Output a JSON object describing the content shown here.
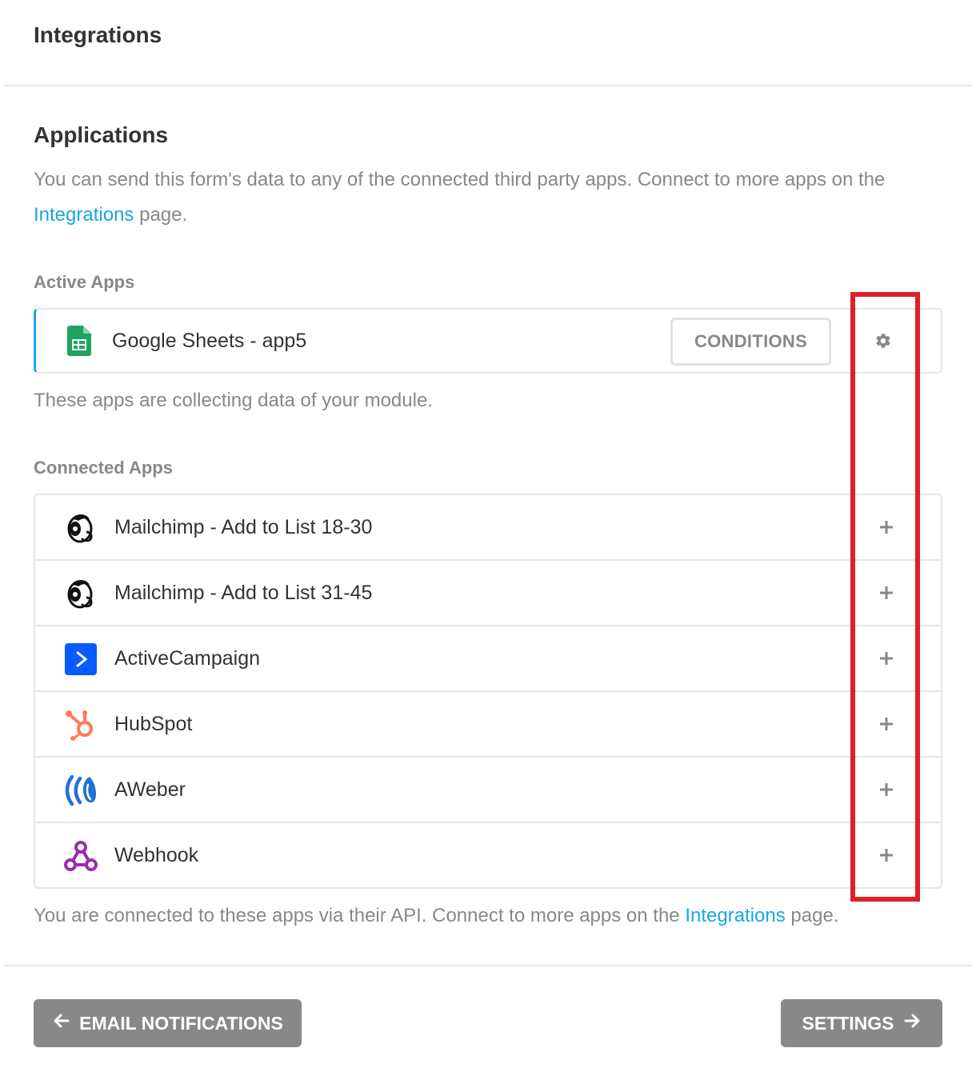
{
  "header": {
    "title": "Integrations"
  },
  "applications": {
    "title": "Applications",
    "description_prefix": "You can send this form's data to any of the connected third party apps. Connect to more apps on the",
    "integrations_link": "Integrations",
    "description_suffix": "page."
  },
  "active_apps": {
    "label": "Active Apps",
    "items": [
      {
        "name": "Google Sheets - app5",
        "icon": "google-sheets-icon",
        "conditions_label": "CONDITIONS",
        "settings_icon": "gear-icon"
      }
    ],
    "note": "These apps are collecting data of your module."
  },
  "connected_apps": {
    "label": "Connected Apps",
    "items": [
      {
        "name": "Mailchimp - Add to List 18-30",
        "icon": "mailchimp-icon",
        "action_icon": "plus-icon"
      },
      {
        "name": "Mailchimp - Add to List 31-45",
        "icon": "mailchimp-icon",
        "action_icon": "plus-icon"
      },
      {
        "name": "ActiveCampaign",
        "icon": "activecampaign-icon",
        "action_icon": "plus-icon"
      },
      {
        "name": "HubSpot",
        "icon": "hubspot-icon",
        "action_icon": "plus-icon"
      },
      {
        "name": "AWeber",
        "icon": "aweber-icon",
        "action_icon": "plus-icon"
      },
      {
        "name": "Webhook",
        "icon": "webhook-icon",
        "action_icon": "plus-icon"
      }
    ],
    "note_prefix": "You are connected to these apps via their API. Connect to more apps on the",
    "integrations_link": "Integrations",
    "note_suffix": "page."
  },
  "footer": {
    "back_label": "EMAIL NOTIFICATIONS",
    "next_label": "SETTINGS"
  },
  "colors": {
    "accent": "#17a8e3",
    "button_gray": "#888888",
    "highlight": "#e02027",
    "border": "#e6e6e6"
  }
}
